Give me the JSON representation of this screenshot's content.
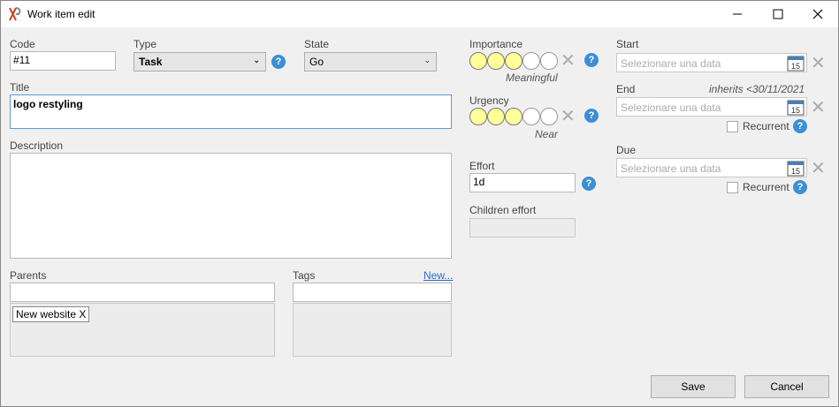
{
  "window": {
    "title": "Work item edit",
    "minimize_icon": "minimize-icon",
    "maximize_icon": "maximize-icon",
    "close_icon": "close-icon"
  },
  "fields": {
    "code": {
      "label": "Code",
      "value": "#11"
    },
    "type": {
      "label": "Type",
      "value": "Task"
    },
    "state": {
      "label": "State",
      "value": "Go"
    },
    "title": {
      "label": "Title",
      "value": "logo restyling"
    },
    "description": {
      "label": "Description",
      "value": ""
    },
    "parents": {
      "label": "Parents",
      "value": "",
      "items": [
        "New website  X"
      ]
    },
    "tags": {
      "label": "Tags",
      "new_link": "New...",
      "value": ""
    },
    "importance": {
      "label": "Importance",
      "level": 3,
      "max": 5,
      "caption": "Meaningful"
    },
    "urgency": {
      "label": "Urgency",
      "level": 3,
      "max": 5,
      "caption": "Near"
    },
    "effort": {
      "label": "Effort",
      "value": "1d"
    },
    "children_effort": {
      "label": "Children effort",
      "value": ""
    },
    "start": {
      "label": "Start",
      "placeholder": "Selezionare una data"
    },
    "end": {
      "label": "End",
      "placeholder": "Selezionare una data",
      "inherits": "inherits <30/11/2021",
      "recurrent_label": "Recurrent"
    },
    "due": {
      "label": "Due",
      "placeholder": "Selezionare una data",
      "recurrent_label": "Recurrent"
    }
  },
  "help_symbol": "?",
  "calendar_day": "15",
  "buttons": {
    "save": "Save",
    "cancel": "Cancel"
  },
  "colors": {
    "rating_on": "#ffff99",
    "help": "#3a8fd6",
    "link": "#2a6bc1"
  }
}
